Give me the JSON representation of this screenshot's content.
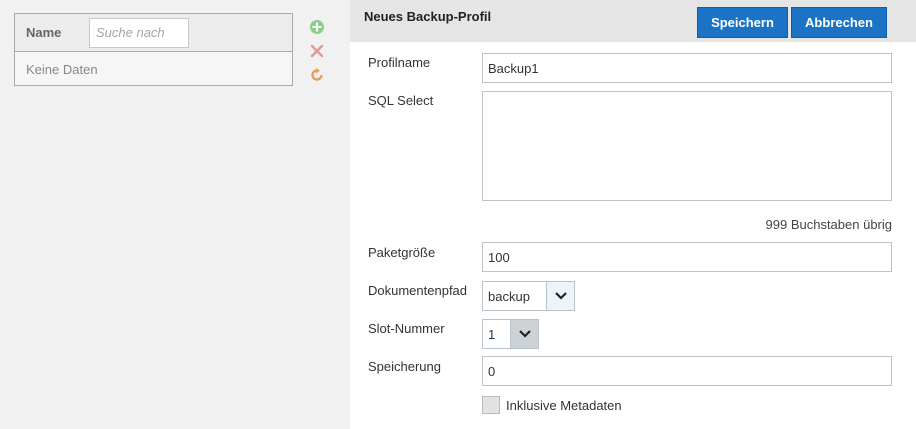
{
  "list": {
    "column_name": "Name",
    "search_placeholder": "Suche nach",
    "empty_text": "Keine Daten",
    "actions": {
      "add_icon": "plus-circle-icon",
      "delete_icon": "x-icon",
      "refresh_icon": "refresh-icon"
    }
  },
  "form": {
    "title": "Neues Backup-Profil",
    "save_label": "Speichern",
    "cancel_label": "Abbrechen",
    "profile_name": {
      "label": "Profilname",
      "value": "Backup1"
    },
    "sql_select": {
      "label": "SQL Select",
      "value": ""
    },
    "chars_left": "999 Buchstaben übrig",
    "package_size": {
      "label": "Paketgröße",
      "value": "100"
    },
    "document_path": {
      "label": "Dokumentenpfad",
      "value": "backup"
    },
    "slot_number": {
      "label": "Slot-Nummer",
      "value": "1"
    },
    "storage": {
      "label": "Speicherung",
      "value": "0"
    },
    "include_metadata": {
      "label": "Inklusive Metadaten",
      "checked": false
    }
  },
  "colors": {
    "primary": "#1a73c4",
    "add_icon": "#8ccf8c",
    "delete_icon": "#e39a9a",
    "refresh_icon": "#e0a060"
  }
}
